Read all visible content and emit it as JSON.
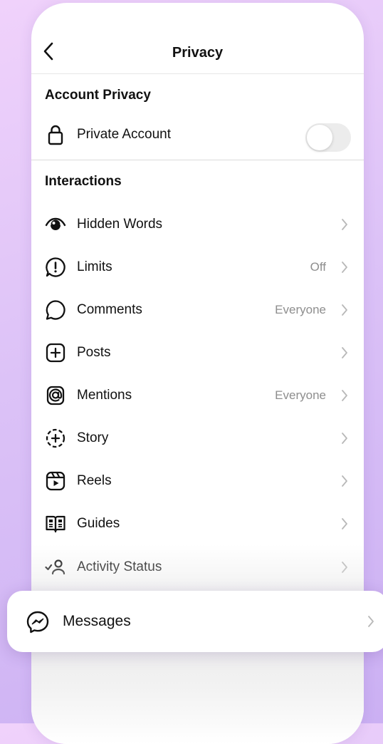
{
  "header": {
    "title": "Privacy"
  },
  "account_privacy": {
    "title": "Account Privacy",
    "private_account": {
      "label": "Private Account",
      "enabled": false
    }
  },
  "interactions": {
    "title": "Interactions",
    "items": [
      {
        "label": "Hidden Words",
        "value": "",
        "icon": "eye-icon"
      },
      {
        "label": "Limits",
        "value": "Off",
        "icon": "limits-alert-icon"
      },
      {
        "label": "Comments",
        "value": "Everyone",
        "icon": "comment-bubble-icon"
      },
      {
        "label": "Posts",
        "value": "",
        "icon": "plus-square-icon"
      },
      {
        "label": "Mentions",
        "value": "Everyone",
        "icon": "at-sign-icon"
      },
      {
        "label": "Story",
        "value": "",
        "icon": "story-plus-icon"
      },
      {
        "label": "Reels",
        "value": "",
        "icon": "reels-icon"
      },
      {
        "label": "Guides",
        "value": "",
        "icon": "guides-book-icon"
      },
      {
        "label": "Activity Status",
        "value": "",
        "icon": "activity-status-icon"
      }
    ]
  },
  "messages": {
    "label": "Messages",
    "icon": "messenger-icon"
  }
}
